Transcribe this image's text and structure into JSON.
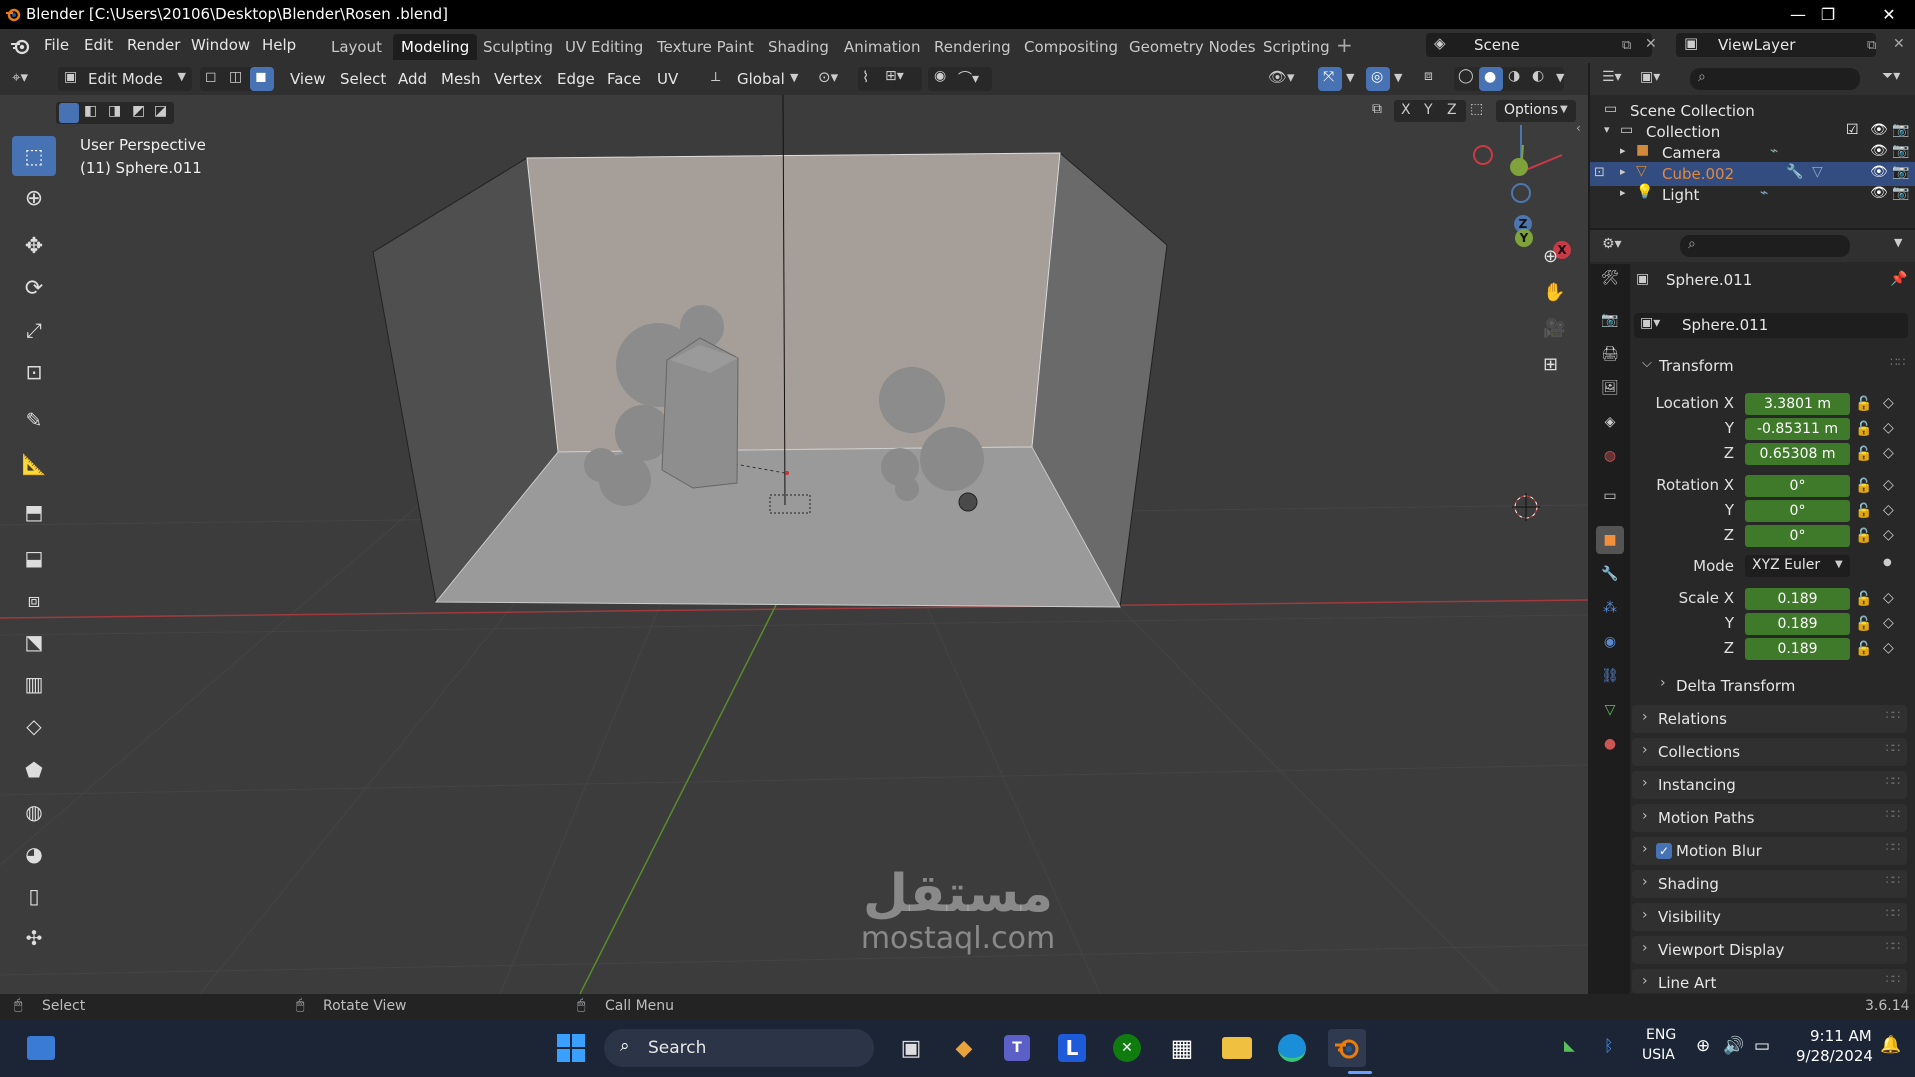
{
  "window": {
    "title": "Blender [C:\\Users\\20106\\Desktop\\Blender\\Rosen .blend]",
    "controls": [
      "—",
      "❐",
      "✕"
    ]
  },
  "menubar": {
    "menus": [
      "File",
      "Edit",
      "Render",
      "Window",
      "Help"
    ],
    "workspaces": [
      "Layout",
      "Modeling",
      "Sculpting",
      "UV Editing",
      "Texture Paint",
      "Shading",
      "Animation",
      "Rendering",
      "Compositing",
      "Geometry Nodes",
      "Scripting"
    ],
    "active_workspace": "Modeling",
    "add_workspace": "+",
    "scene": "Scene",
    "view_layer": "ViewLayer"
  },
  "viewport_header": {
    "mode": "Edit Mode",
    "menus": [
      "View",
      "Select",
      "Add",
      "Mesh",
      "Vertex",
      "Edge",
      "Face",
      "UV"
    ],
    "orientation": "Global",
    "axes": [
      "X",
      "Y",
      "Z"
    ],
    "options": "Options"
  },
  "viewport": {
    "perspective": "User Perspective",
    "object": "(11) Sphere.011",
    "gizmo_axes": {
      "x": "X",
      "y": "Y",
      "z": "Z"
    }
  },
  "outliner": {
    "root": "Scene Collection",
    "collection": "Collection",
    "items": [
      {
        "name": "Camera",
        "color": "#e6e6e6"
      },
      {
        "name": "Cube.002",
        "color": "#e0883c"
      },
      {
        "name": "Light",
        "color": "#e6e6e6"
      }
    ]
  },
  "properties": {
    "object_name": "Sphere.011",
    "data_name": "Sphere.011",
    "transform_title": "Transform",
    "location": {
      "label": "Location X",
      "x": "3.3801 m",
      "y": "-0.85311 m",
      "z": "0.65308 m"
    },
    "rotation": {
      "label": "Rotation X",
      "x": "0°",
      "y": "0°",
      "z": "0°"
    },
    "mode_label": "Mode",
    "mode_value": "XYZ Euler",
    "scale": {
      "label": "Scale X",
      "x": "0.189",
      "y": "0.189",
      "z": "0.189"
    },
    "axis_y": "Y",
    "axis_z": "Z",
    "delta_transform": "Delta Transform",
    "panels": [
      "Relations",
      "Collections",
      "Instancing",
      "Motion Paths",
      "Motion Blur",
      "Shading",
      "Visibility",
      "Viewport Display",
      "Line Art"
    ]
  },
  "statusbar": {
    "select": "Select",
    "rotate": "Rotate View",
    "call_menu": "Call Menu",
    "version": "3.6.14"
  },
  "taskbar": {
    "search": "Search",
    "lang1": "ENG",
    "lang2": "USIA",
    "time": "9:11 AM",
    "date": "9/28/2024"
  },
  "watermark": {
    "arabic": "مستقل",
    "latin": "mostaql.com"
  },
  "colors": {
    "accent": "#4772b3",
    "field_green": "#3f7a2b",
    "selected_object": "#e0883c"
  }
}
